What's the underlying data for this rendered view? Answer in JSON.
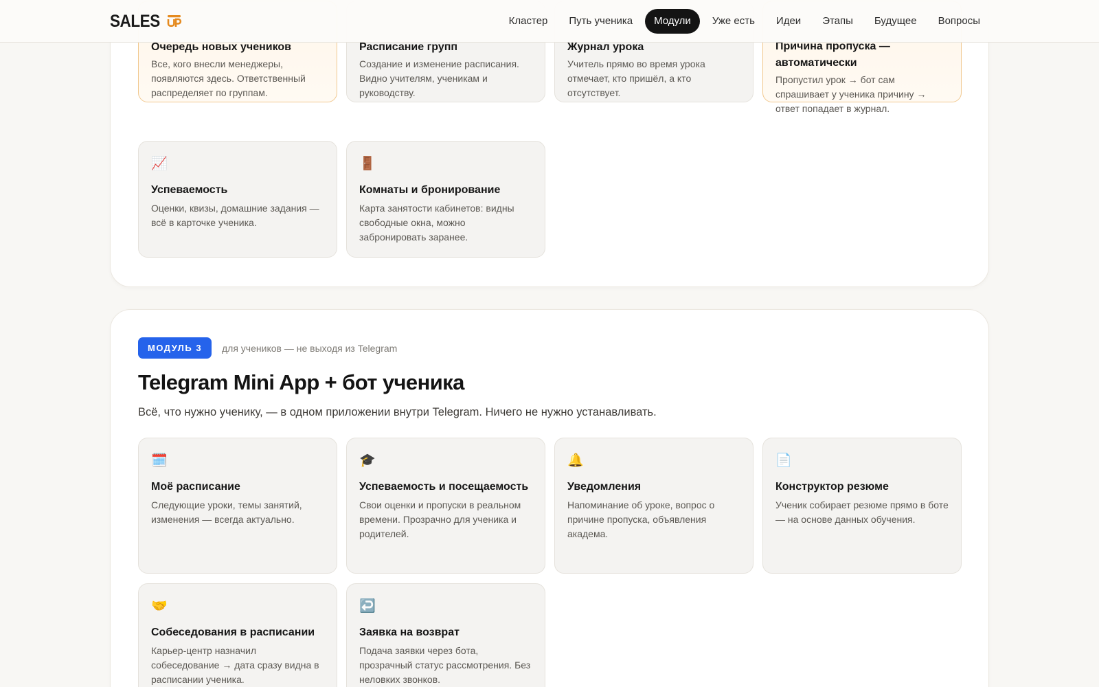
{
  "logo": {
    "text": "SALES",
    "mark_color": "#e58a1f"
  },
  "nav": {
    "items": [
      {
        "label": "Кластер",
        "active": false
      },
      {
        "label": "Путь ученика",
        "active": false
      },
      {
        "label": "Модули",
        "active": true
      },
      {
        "label": "Уже есть",
        "active": false
      },
      {
        "label": "Идеи",
        "active": false
      },
      {
        "label": "Этапы",
        "active": false
      },
      {
        "label": "Будущее",
        "active": false
      },
      {
        "label": "Вопросы",
        "active": false
      }
    ]
  },
  "module2": {
    "cards": [
      {
        "title": "Очередь новых учеников",
        "text": "Все, кого внесли менеджеры, появляются здесь. Ответственный распределяет по группам.",
        "highlight": true
      },
      {
        "title": "Расписание групп",
        "text": "Создание и изменение расписания. Видно учителям, ученикам и руководству.",
        "highlight": false
      },
      {
        "title": "Журнал урока",
        "text": "Учитель прямо во время урока отмечает, кто пришёл, а кто отсутствует.",
        "highlight": false
      },
      {
        "title": "Причина пропуска — автоматически",
        "text": "Пропустил урок → бот сам спрашивает у ученика причину → ответ попадает в журнал.",
        "highlight": true
      },
      {
        "icon": "📈",
        "icon_name": "chart-increasing-icon",
        "title": "Успеваемость",
        "text": "Оценки, квизы, домашние задания — всё в карточке ученика.",
        "highlight": false
      },
      {
        "icon": "🚪",
        "icon_name": "door-icon",
        "title": "Комнаты и бронирование",
        "text": "Карта занятости кабинетов: видны свободные окна, можно забронировать заранее.",
        "highlight": false
      }
    ]
  },
  "module3": {
    "badge": "МОДУЛЬ 3",
    "badge_color": "#2563eb",
    "note": "для учеников — не выходя из Telegram",
    "title": "Telegram Mini App + бот ученика",
    "subtitle": "Всё, что нужно ученику, — в одном приложении внутри Telegram. Ничего не нужно устанавливать.",
    "cards": [
      {
        "icon": "🗓️",
        "icon_name": "calendar-icon",
        "title": "Моё расписание",
        "text": "Следующие уроки, темы занятий, изменения — всегда актуально."
      },
      {
        "icon": "🎓",
        "icon_name": "graduation-cap-icon",
        "title": "Успеваемость и посещаемость",
        "text": "Свои оценки и пропуски в реальном времени. Прозрачно для ученика и родителей."
      },
      {
        "icon": "🔔",
        "icon_name": "bell-icon",
        "title": "Уведомления",
        "text": "Напоминание об уроке, вопрос о причине пропуска, объявления академа."
      },
      {
        "icon": "📄",
        "icon_name": "document-icon",
        "title": "Конструктор резюме",
        "text": "Ученик собирает резюме прямо в боте — на основе данных обучения."
      },
      {
        "icon": "🤝",
        "icon_name": "handshake-icon",
        "title": "Собеседования в расписании",
        "text": "Карьер-центр назначил собеседование → дата сразу видна в расписании ученика."
      },
      {
        "icon": "↩️",
        "icon_name": "return-arrow-icon",
        "title": "Заявка на возврат",
        "text": "Подача заявки через бота, прозрачный статус рассмотрения. Без неловких звонков."
      }
    ]
  }
}
